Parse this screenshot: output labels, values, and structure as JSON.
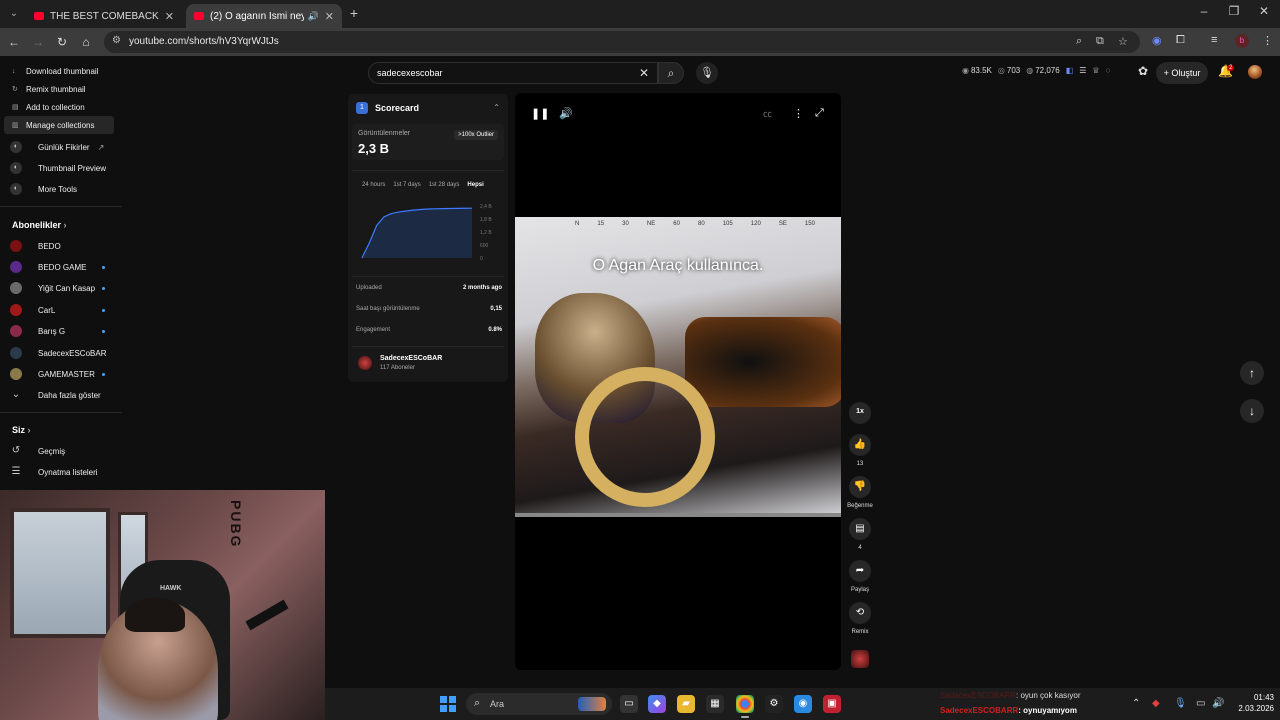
{
  "browser": {
    "tabs": [
      {
        "title": "THE BEST COMEBACK💀‼️ #pu",
        "active": false
      },
      {
        "title": "(2) O aganın İsmi ney? - Yo",
        "active": true
      }
    ],
    "url": "youtube.com/shorts/hV3YqrWJtJs",
    "profile_initial": "b"
  },
  "header": {
    "search_value": "sadecexescobar",
    "stats": [
      "83.5K",
      "703",
      "72,076"
    ],
    "create_label": "Oluştur",
    "notification_count": "2"
  },
  "context_menu": {
    "items": [
      "Download thumbnail",
      "Remix thumbnail",
      "Add to collection",
      "Manage collections"
    ]
  },
  "sidebar": {
    "tools": [
      "Günlük Fikirler",
      "Thumbnail Preview",
      "More Tools"
    ],
    "subs_heading": "Abonelikler",
    "subscriptions": [
      "BEDO",
      "BEDO GAME",
      "Yiğit Can Kasap",
      "CarL",
      "Barış G",
      "SadecexESCoBAR",
      "GAMEMASTER"
    ],
    "show_more": "Daha fazla göster",
    "you_heading": "Siz",
    "you_items": [
      "Geçmiş",
      "Oynatma listeleri"
    ]
  },
  "scorecard": {
    "title": "Scorecard",
    "views_label": "Görüntülenmeler",
    "views_value": "2,3 B",
    "outlier_badge": ">100x Outlier",
    "ranges": [
      "24 hours",
      "1st 7 days",
      "1st 28 days",
      "Hepsi"
    ],
    "selected_range": "Hepsi",
    "y_ticks": [
      "2,4 B",
      "1,8 B",
      "1,2 B",
      "600",
      "0"
    ],
    "chart_data": {
      "type": "line",
      "series": [
        {
          "values": [
            0,
            700,
            1500,
            1900,
            2050,
            2120,
            2170,
            2210,
            2240,
            2260,
            2270,
            2280,
            2285,
            2290,
            2295,
            2300
          ]
        }
      ],
      "ylim": [
        0,
        2400
      ]
    },
    "metrics": [
      {
        "label": "Uploaded",
        "value": "2 months ago"
      },
      {
        "label": "Saat başı görüntülenme",
        "value": "0,15"
      },
      {
        "label": "Engagement",
        "value": "0.8%"
      }
    ],
    "channel_name": "SadecexESCoBAR",
    "channel_subs": "117 Aboneler"
  },
  "video": {
    "subtitle": "O Agan Araç kullanınca.",
    "compass": [
      "N",
      "15",
      "30",
      "NE",
      "60",
      "80",
      "105",
      "120",
      "SE",
      "150"
    ]
  },
  "actions": {
    "speed": "1x",
    "like_count": "13",
    "dislike_label": "Beğenme",
    "comment_count": "4",
    "share_label": "Paylaş",
    "remix_label": "Remix"
  },
  "webcam": {
    "poster_text": "PUBG",
    "chair_brand": "HAWK"
  },
  "taskbar": {
    "search_placeholder": "Ara",
    "chat": [
      {
        "user": "SadecexESCOBARR",
        "message": ": oyun çok kasıyor"
      },
      {
        "user": "SadecexESCOBARR",
        "message": ": oynuyamıyom"
      }
    ],
    "time": "01:43",
    "date": "2.03.2026"
  }
}
